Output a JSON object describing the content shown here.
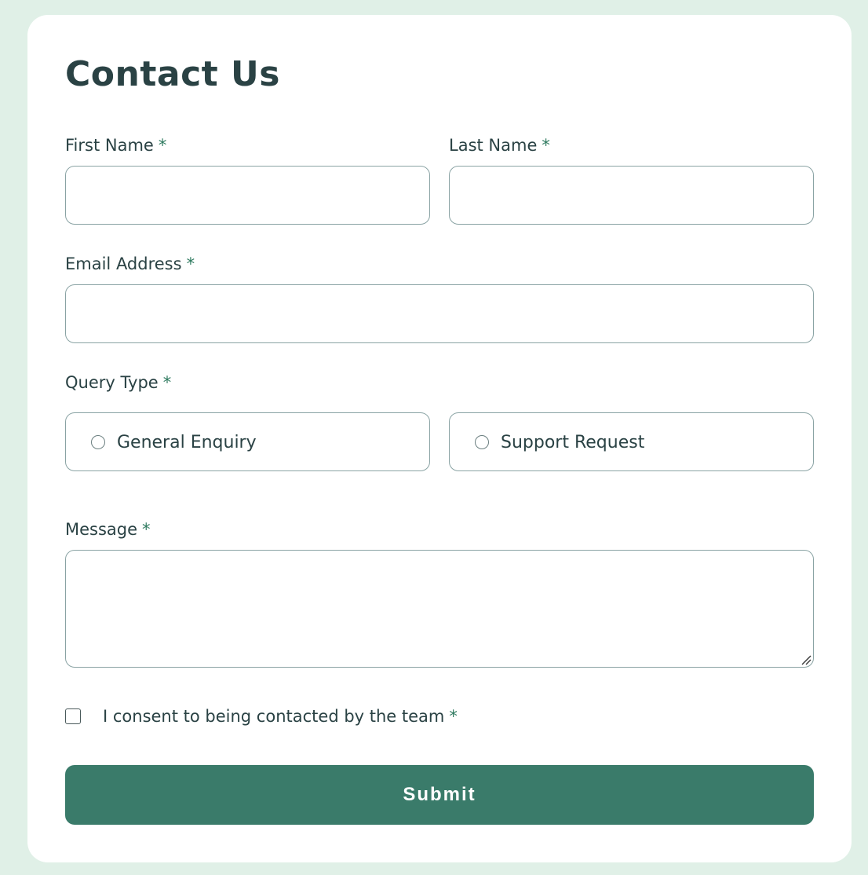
{
  "form": {
    "title": "Contact Us",
    "required_marker": "*",
    "first_name": {
      "label": "First Name",
      "value": ""
    },
    "last_name": {
      "label": "Last Name",
      "value": ""
    },
    "email": {
      "label": "Email Address",
      "value": ""
    },
    "query_type": {
      "label": "Query Type",
      "options": [
        {
          "label": "General Enquiry",
          "selected": false
        },
        {
          "label": "Support Request",
          "selected": false
        }
      ]
    },
    "message": {
      "label": "Message",
      "value": ""
    },
    "consent": {
      "label": "I consent to being contacted by the team",
      "checked": false
    },
    "submit_label": "Submit"
  },
  "colors": {
    "page_background": "#e0f0e7",
    "card_background": "#ffffff",
    "accent": "#3a7b6a",
    "required_marker": "#2e7a5f",
    "text": "#2a4244",
    "field_border": "#8aa3a4"
  },
  "icons": {
    "radio": "radio-unchecked-icon",
    "checkbox": "checkbox-unchecked-icon",
    "resize": "resize-handle-icon"
  }
}
